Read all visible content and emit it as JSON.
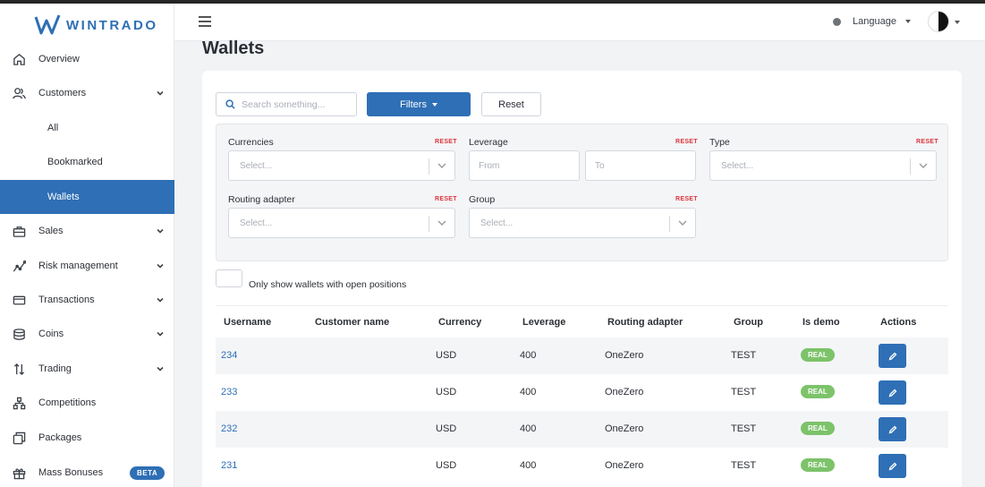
{
  "brand": {
    "name": "WINTRADO"
  },
  "sidebar": {
    "items": [
      {
        "label": "Overview",
        "icon": "home-icon"
      },
      {
        "label": "Customers",
        "icon": "users-icon"
      },
      {
        "label": "All"
      },
      {
        "label": "Bookmarked"
      },
      {
        "label": "Wallets"
      },
      {
        "label": "Sales",
        "icon": "briefcase-icon"
      },
      {
        "label": "Risk management",
        "icon": "chart-line-icon"
      },
      {
        "label": "Transactions",
        "icon": "credit-card-icon"
      },
      {
        "label": "Coins",
        "icon": "coins-icon"
      },
      {
        "label": "Trading",
        "icon": "arrows-updown-icon"
      },
      {
        "label": "Competitions",
        "icon": "network-icon"
      },
      {
        "label": "Packages",
        "icon": "packages-icon"
      },
      {
        "label": "Mass Bonuses",
        "icon": "gift-icon",
        "badge": "BETA"
      }
    ]
  },
  "header": {
    "language_label": "Language"
  },
  "page": {
    "title": "Wallets"
  },
  "toolbar": {
    "search_placeholder": "Search something...",
    "filters_label": "Filters",
    "reset_label": "Reset"
  },
  "filters": {
    "reset_label": "RESET",
    "currencies": {
      "label": "Currencies",
      "placeholder": "Select..."
    },
    "leverage": {
      "label": "Leverage",
      "from_placeholder": "From",
      "to_placeholder": "To"
    },
    "type": {
      "label": "Type",
      "placeholder": "Select..."
    },
    "routing_adapter": {
      "label": "Routing adapter",
      "placeholder": "Select..."
    },
    "group": {
      "label": "Group",
      "placeholder": "Select..."
    }
  },
  "open_positions_toggle": {
    "label": "Only show wallets with open positions",
    "checked": false
  },
  "table": {
    "columns": [
      "Username",
      "Customer name",
      "Currency",
      "Leverage",
      "Routing adapter",
      "Group",
      "Is demo",
      "Actions"
    ],
    "rows": [
      {
        "username": "234",
        "customer_name": "",
        "currency": "USD",
        "leverage": "400",
        "routing_adapter": "OneZero",
        "group": "TEST",
        "is_demo": "REAL"
      },
      {
        "username": "233",
        "customer_name": "",
        "currency": "USD",
        "leverage": "400",
        "routing_adapter": "OneZero",
        "group": "TEST",
        "is_demo": "REAL"
      },
      {
        "username": "232",
        "customer_name": "",
        "currency": "USD",
        "leverage": "400",
        "routing_adapter": "OneZero",
        "group": "TEST",
        "is_demo": "REAL"
      },
      {
        "username": "231",
        "customer_name": "",
        "currency": "USD",
        "leverage": "400",
        "routing_adapter": "OneZero",
        "group": "TEST",
        "is_demo": "REAL"
      }
    ]
  },
  "colors": {
    "primary": "#2e6fb5",
    "success": "#7cc36a",
    "danger": "#d8343a"
  }
}
